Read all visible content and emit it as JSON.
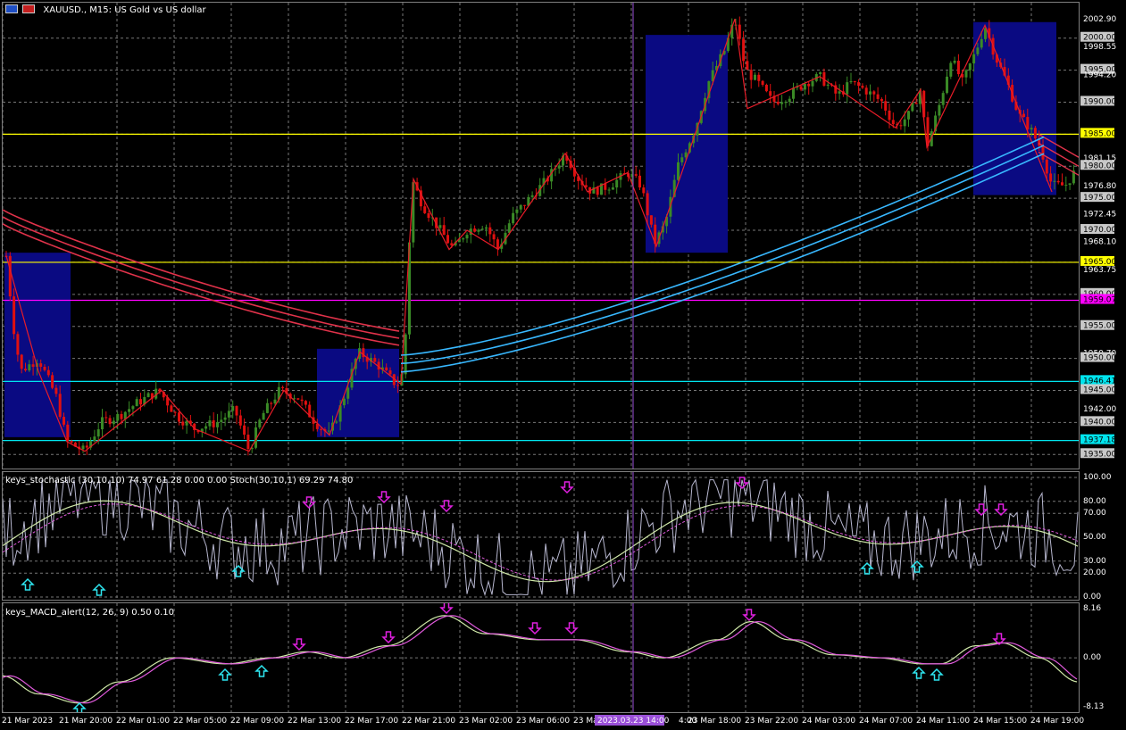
{
  "window": {
    "symbol_title": "XAUUSD., M15:  US Gold vs US dollar"
  },
  "price_pane": {
    "y_min": 1934.2,
    "y_max": 2004.0,
    "tick_labels": [
      "2002.90",
      "2000.00",
      "1998.55",
      "1995.00",
      "1994.20",
      "1990.00",
      "1985.00",
      "1981.15",
      "1980.00",
      "1976.80",
      "1975.00",
      "1972.45",
      "1970.00",
      "1968.10",
      "1965.00",
      "1963.75",
      "1960.00",
      "1959.07",
      "1955.00",
      "1950.70",
      "1950.00",
      "1946.41",
      "1945.00",
      "1942.00",
      "1940.00",
      "1937.18",
      "1935.00"
    ],
    "tagged_labels": [
      {
        "value": "1985.00",
        "color": "#ffff00"
      },
      {
        "value": "1965.00",
        "color": "#ffff00"
      },
      {
        "value": "1959.07",
        "color": "#ff00ff"
      },
      {
        "value": "1946.41",
        "color": "#00e5ee"
      },
      {
        "value": "1937.18",
        "color": "#00e5ee"
      }
    ],
    "horizontal_lines": [
      {
        "price": 1985.0,
        "color": "#ffff00"
      },
      {
        "price": 1965.0,
        "color": "#ffff00"
      },
      {
        "price": 1959.07,
        "color": "#ff00ff"
      },
      {
        "price": 1946.41,
        "color": "#00e5ee"
      },
      {
        "price": 1937.18,
        "color": "#00e5ee"
      }
    ],
    "zones_color": "#0a0a82",
    "candle_up_color": "#3a8a26",
    "candle_down_color": "#e01010",
    "ema_red_color": "#e0324a",
    "ema_blue_color": "#38b8ff"
  },
  "stoch_pane": {
    "title": "keys_stochastic (30,10,10) 74.97 61.28 0.00 0.00 Stoch(30,10,1) 69.29 74.80",
    "tick_labels": [
      "100.00",
      "80.00",
      "70.00",
      "50.00",
      "30.00",
      "20.00",
      "0.00"
    ]
  },
  "macd_pane": {
    "title": "keys_MACD_alert(12, 26, 9) 0.50 0.10",
    "tick_labels": [
      "8.16",
      "0.00",
      "-8.13"
    ]
  },
  "time_axis": {
    "labels": [
      "21 Mar 2023",
      "21 Mar 20:00",
      "22 Mar 01:00",
      "22 Mar 05:00",
      "22 Mar 09:00",
      "22 Mar 13:00",
      "22 Mar 17:00",
      "22 Mar 21:00",
      "23 Mar 02:00",
      "23 Mar 06:00",
      "23 Mar",
      "4:00",
      "23 Mar 18:00",
      "23 Mar 22:00",
      "24 Mar 03:00",
      "24 Mar 07:00",
      "24 Mar 11:00",
      "24 Mar 15:00",
      "24 Mar 19:00"
    ],
    "crosshair_label": "2023.03.23 14:00",
    "crosshair_label_color": "#9a4fd8"
  },
  "chart_data": [
    {
      "type": "candlestick",
      "title": "XAUUSD., M15:  US Gold vs US dollar",
      "ylim": [
        1934.2,
        2004.0
      ],
      "x": [
        "21 Mar 2023",
        "21 Mar 20:00",
        "22 Mar 01:00",
        "22 Mar 05:00",
        "22 Mar 09:00",
        "22 Mar 13:00",
        "22 Mar 17:00",
        "22 Mar 21:00",
        "23 Mar 02:00",
        "23 Mar 06:00",
        "23 Mar 10:00",
        "23 Mar 14:00",
        "23 Mar 18:00",
        "23 Mar 22:00",
        "24 Mar 03:00",
        "24 Mar 07:00",
        "24 Mar 11:00",
        "24 Mar 15:00",
        "24 Mar 19:00"
      ],
      "approx_close": [
        1966,
        1937,
        1942,
        1939,
        1943,
        1938,
        1949,
        1976,
        1969,
        1981,
        1976,
        1968,
        2002,
        1990,
        1992,
        1986,
        1996,
        1990,
        1977
      ],
      "grid": true
    },
    {
      "type": "line",
      "title": "keys_stochastic (30,10,10)",
      "ylim": [
        0,
        100
      ],
      "last_values": [
        74.97,
        61.28,
        0.0,
        0.0,
        69.29,
        74.8
      ]
    },
    {
      "type": "line",
      "title": "keys_MACD_alert(12, 26, 9)",
      "ylim": [
        -8.13,
        8.16
      ],
      "last_values": [
        0.5,
        0.1
      ]
    }
  ]
}
